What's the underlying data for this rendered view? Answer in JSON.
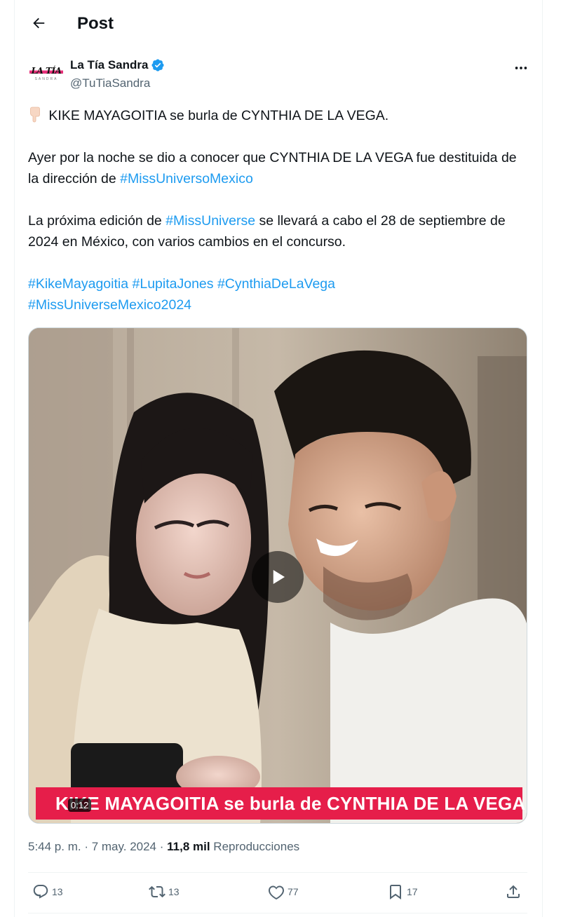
{
  "header": {
    "title": "Post"
  },
  "author": {
    "name": "La Tía Sandra",
    "handle": "@TuTiaSandra",
    "avatar_logo": "LA TÍA",
    "avatar_sub": "SANDRA"
  },
  "post": {
    "line1": "KIKE MAYAGOITIA se burla de CYNTHIA DE LA VEGA.",
    "p2_text": "Ayer por la noche se dio a conocer que CYNTHIA DE LA VEGA fue destituida de la dirección de ",
    "p2_hashtag": "#MissUniversoMexico",
    "p3_start": "La próxima edición de ",
    "p3_hashtag": "#MissUniverse",
    "p3_end": " se llevará a cabo el 28 de septiembre de 2024 en México, con varios cambios en el concurso.",
    "hashtags_line1": [
      "#KikeMayagoitia",
      "#LupitaJones",
      "#CynthiaDeLaVega"
    ],
    "hashtags_line2": "#MissUniverseMexico2024"
  },
  "media": {
    "caption": "KIKE MAYAGOITIA se burla de CYNTHIA DE LA VEGA",
    "duration": "0:12"
  },
  "meta": {
    "time": "5:44 p. m.",
    "separator": " · ",
    "date": "7 may. 2024",
    "views": "11,8 mil",
    "views_label": "Reproducciones"
  },
  "actions": {
    "replies": "13",
    "reposts": "13",
    "likes": "77",
    "bookmarks": "17"
  },
  "colors": {
    "link": "#1d9bf0",
    "secondary_text": "#536471",
    "caption_bg": "#e61e4a",
    "verified": "#1d9bf0"
  },
  "icons": {
    "back": "arrow-left-icon",
    "more": "more-dots-icon",
    "verified": "verified-badge-icon",
    "play": "play-icon",
    "reply": "reply-icon",
    "repost": "repost-icon",
    "like": "heart-icon",
    "bookmark": "bookmark-icon",
    "share": "share-icon"
  }
}
